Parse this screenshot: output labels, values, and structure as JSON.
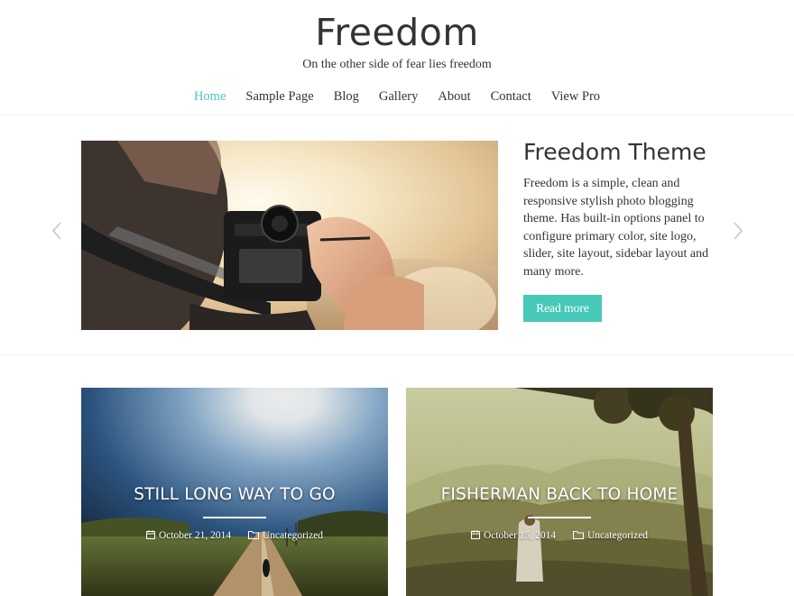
{
  "site": {
    "title": "Freedom",
    "tagline": "On the other side of fear lies freedom"
  },
  "nav": {
    "items": [
      {
        "label": "Home",
        "active": true
      },
      {
        "label": "Sample Page"
      },
      {
        "label": "Blog"
      },
      {
        "label": "Gallery"
      },
      {
        "label": "About"
      },
      {
        "label": "Contact"
      },
      {
        "label": "View Pro"
      }
    ]
  },
  "slider": {
    "title": "Freedom Theme",
    "text": "Freedom is a simple, clean and responsive stylish photo blogging theme. Has built-in options panel to configure primary color, site logo, slider, site layout, sidebar layout and many more.",
    "button_label": "Read more",
    "prev_icon": "chevron-left-icon",
    "next_icon": "chevron-right-icon"
  },
  "posts": [
    {
      "title": "STILL LONG WAY TO GO",
      "date": "October 21, 2014",
      "category": "Uncategorized"
    },
    {
      "title": "FISHERMAN BACK TO HOME",
      "date": "October 15, 2014",
      "category": "Uncategorized"
    }
  ],
  "colors": {
    "accent": "#46c9b7",
    "text": "#333333",
    "background": "#ffffff"
  }
}
